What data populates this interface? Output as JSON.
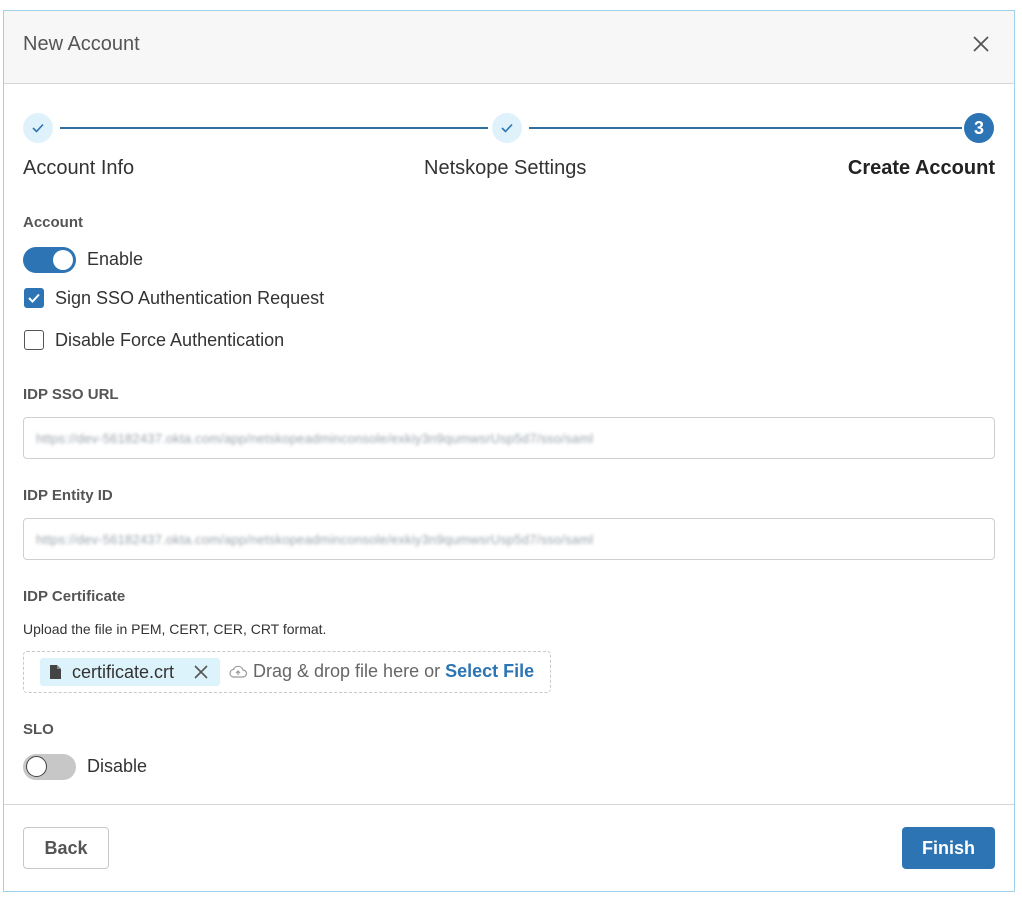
{
  "dialog": {
    "title": "New Account"
  },
  "stepper": {
    "steps": [
      {
        "label": "Account Info",
        "state": "done"
      },
      {
        "label": "Netskope Settings",
        "state": "done"
      },
      {
        "label": "Create Account",
        "state": "active",
        "number": "3"
      }
    ]
  },
  "account": {
    "section_label": "Account",
    "enable_label": "Enable",
    "enabled": true,
    "sign_sso_label": "Sign SSO Authentication Request",
    "sign_sso_checked": true,
    "disable_force_label": "Disable Force Authentication",
    "disable_force_checked": false
  },
  "idp_sso_url": {
    "label": "IDP SSO URL",
    "value": "https://dev-56182437.okta.com/app/netskopeadminconsole/exkiy3n9qumwsrUsp5d7/sso/saml"
  },
  "idp_entity_id": {
    "label": "IDP Entity ID",
    "value": "https://dev-56182437.okta.com/app/netskopeadminconsole/exkiy3n9qumwsrUsp5d7/sso/saml"
  },
  "idp_certificate": {
    "label": "IDP Certificate",
    "hint": "Upload the file in PEM, CERT, CER, CRT format.",
    "file_name": "certificate.crt",
    "drop_text": "Drag & drop file here or",
    "select_file_label": "Select File"
  },
  "slo": {
    "label": "SLO",
    "toggle_label": "Disable",
    "enabled": false
  },
  "footer": {
    "back_label": "Back",
    "finish_label": "Finish"
  },
  "colors": {
    "accent": "#2c74b3",
    "step_done_bg": "#dff2fb",
    "chip_bg": "#ddf3fb",
    "header_bg": "#f7f7f7"
  }
}
